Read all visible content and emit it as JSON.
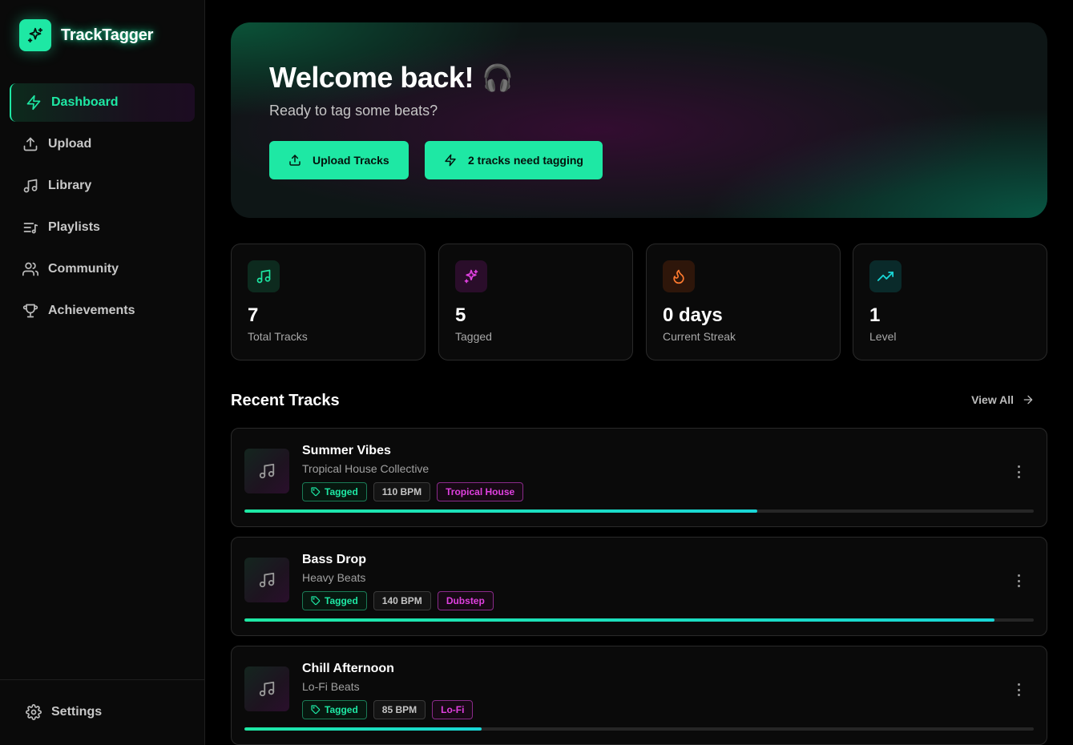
{
  "app": {
    "name": "TrackTagger"
  },
  "sidebar": {
    "items": [
      {
        "label": "Dashboard",
        "icon": "zap-icon",
        "active": true
      },
      {
        "label": "Upload",
        "icon": "upload-icon"
      },
      {
        "label": "Library",
        "icon": "music-icon"
      },
      {
        "label": "Playlists",
        "icon": "playlist-icon"
      },
      {
        "label": "Community",
        "icon": "users-icon"
      },
      {
        "label": "Achievements",
        "icon": "trophy-icon"
      }
    ],
    "settings_label": "Settings"
  },
  "hero": {
    "title": "Welcome back!",
    "emoji": "🎧",
    "subtitle": "Ready to tag some beats?",
    "upload_button": "Upload Tracks",
    "tagging_button": "2 tracks need tagging"
  },
  "stats": [
    {
      "value": "7",
      "label": "Total Tracks",
      "icon": "music-icon",
      "color": "#1ee8a4"
    },
    {
      "value": "5",
      "label": "Tagged",
      "icon": "sparkles-icon",
      "color": "#e040e0"
    },
    {
      "value": "0 days",
      "label": "Current Streak",
      "icon": "flame-icon",
      "color": "#ff7a2f"
    },
    {
      "value": "1",
      "label": "Level",
      "icon": "trending-up-icon",
      "color": "#19d6d6"
    }
  ],
  "recent": {
    "title": "Recent Tracks",
    "view_all": "View All",
    "tracks": [
      {
        "title": "Summer Vibes",
        "artist": "Tropical House Collective",
        "status": "Tagged",
        "bpm": "110 BPM",
        "genre": "Tropical House",
        "progress": 0.65
      },
      {
        "title": "Bass Drop",
        "artist": "Heavy Beats",
        "status": "Tagged",
        "bpm": "140 BPM",
        "genre": "Dubstep",
        "progress": 0.95
      },
      {
        "title": "Chill Afternoon",
        "artist": "Lo-Fi Beats",
        "status": "Tagged",
        "bpm": "85 BPM",
        "genre": "Lo-Fi",
        "progress": 0.3
      }
    ]
  },
  "colors": {
    "accent": "#1ee8a4",
    "magenta": "#e040e0",
    "cyan": "#19d6d6",
    "orange": "#ff7a2f"
  }
}
